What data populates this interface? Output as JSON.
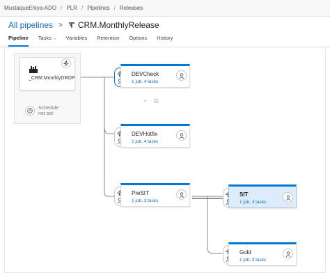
{
  "breadcrumb": {
    "items": [
      "MustaqueEhiya-ADO",
      "PLR",
      "Pipelines",
      "Releases"
    ]
  },
  "header": {
    "back_link": "All pipelines",
    "title": "CRM.MonthlyRelease"
  },
  "tabs": [
    {
      "label": "Pipeline"
    },
    {
      "label": "Tasks"
    },
    {
      "label": "Variables"
    },
    {
      "label": "Retention"
    },
    {
      "label": "Options"
    },
    {
      "label": "History"
    }
  ],
  "artifact": {
    "name": "_CRM.MonthlyDROP",
    "schedule_line1": "Schedule",
    "schedule_line2": "not set"
  },
  "stages": [
    {
      "name": "DEVCheck",
      "tasks": "1 job, 4 tasks"
    },
    {
      "name": "DEVHotfix",
      "tasks": "1 job, 4 tasks"
    },
    {
      "name": "PreSIT",
      "tasks": "1 job, 3 tasks"
    },
    {
      "name": "SIT",
      "tasks": "1 job, 3 tasks"
    },
    {
      "name": "Gold",
      "tasks": "1 job, 3 tasks"
    }
  ],
  "stage_actions": {
    "add": "+",
    "clone": "⧉"
  },
  "colors": {
    "accent": "#0078d4",
    "link": "#106ebe",
    "selected_bg": "#deecf9"
  }
}
